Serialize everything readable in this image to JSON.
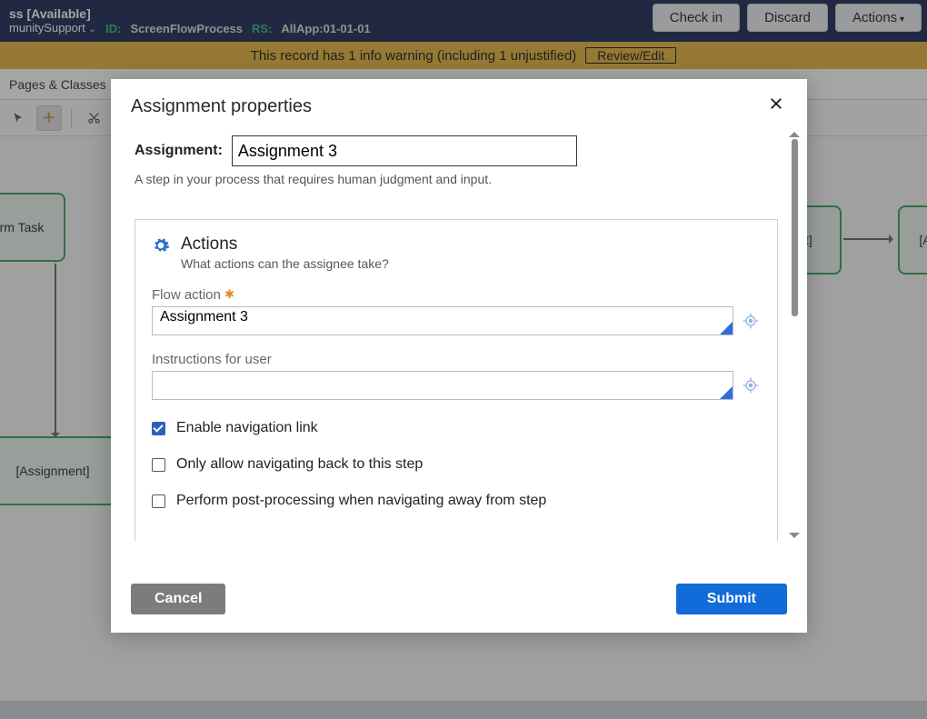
{
  "header": {
    "title_suffix": "ss [Available]",
    "context": "munitySupport",
    "id_label": "ID:",
    "id_value": "ScreenFlowProcess",
    "rs_label": "RS:",
    "rs_value": "AllApp:01-01-01",
    "buttons": {
      "checkin": "Check in",
      "discard": "Discard",
      "actions": "Actions"
    }
  },
  "warning": {
    "text": "This record has 1 info warning (including 1 unjustified)",
    "review": "Review/Edit"
  },
  "subtab": {
    "label": "Pages & Classes"
  },
  "flow_nodes": {
    "n1": "rm Task",
    "n2": "[Assignment]",
    "n3_suffix": "nt]",
    "n4_prefix": "[A"
  },
  "modal": {
    "title": "Assignment properties",
    "assignment_label": "Assignment:",
    "assignment_value": "Assignment 3",
    "helper": "A step in your process that requires human judgment and input.",
    "panel": {
      "title": "Actions",
      "sub": "What actions can the assignee take?",
      "flow_action_label": "Flow action",
      "flow_action_value": "Assignment 3",
      "instructions_label": "Instructions for user",
      "instructions_value": "",
      "chk1": "Enable navigation link",
      "chk2": "Only allow navigating back to this step",
      "chk3": "Perform post-processing when navigating away from step"
    },
    "cancel": "Cancel",
    "submit": "Submit"
  }
}
